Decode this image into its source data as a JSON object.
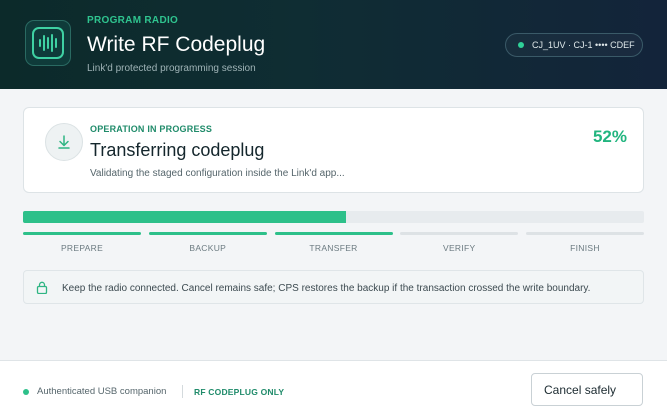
{
  "header": {
    "eyebrow": "PROGRAM RADIO",
    "title": "Write RF Codeplug",
    "subtitle": "Link'd protected programming session",
    "app_icon": "waveform-icon",
    "device_label": "CJ_1UV · CJ-1 •••• CDEF",
    "device_status_color": "#2fd198"
  },
  "operation": {
    "eyebrow": "OPERATION IN PROGRESS",
    "title": "Transferring codeplug",
    "description": "Validating the staged configuration inside the Link'd app...",
    "percent_label": "52%",
    "progress": 0.52,
    "icon": "download-arrow-icon"
  },
  "steps": [
    {
      "label": "PREPARE",
      "state": "done"
    },
    {
      "label": "BACKUP",
      "state": "done"
    },
    {
      "label": "TRANSFER",
      "state": "active"
    },
    {
      "label": "VERIFY",
      "state": "pending"
    },
    {
      "label": "FINISH",
      "state": "pending"
    }
  ],
  "notice": {
    "icon": "lock-icon",
    "text": "Keep the radio connected. Cancel remains safe; CPS restores the backup if the transaction crossed the write boundary."
  },
  "footer": {
    "status_text": "Authenticated USB companion",
    "mode_label": "RF CODEPLUG ONLY",
    "cancel_label": "Cancel safely"
  },
  "colors": {
    "accent": "#2dc08a",
    "accent_dark": "#1f8b6a",
    "header_bg": "#0f2d33"
  }
}
